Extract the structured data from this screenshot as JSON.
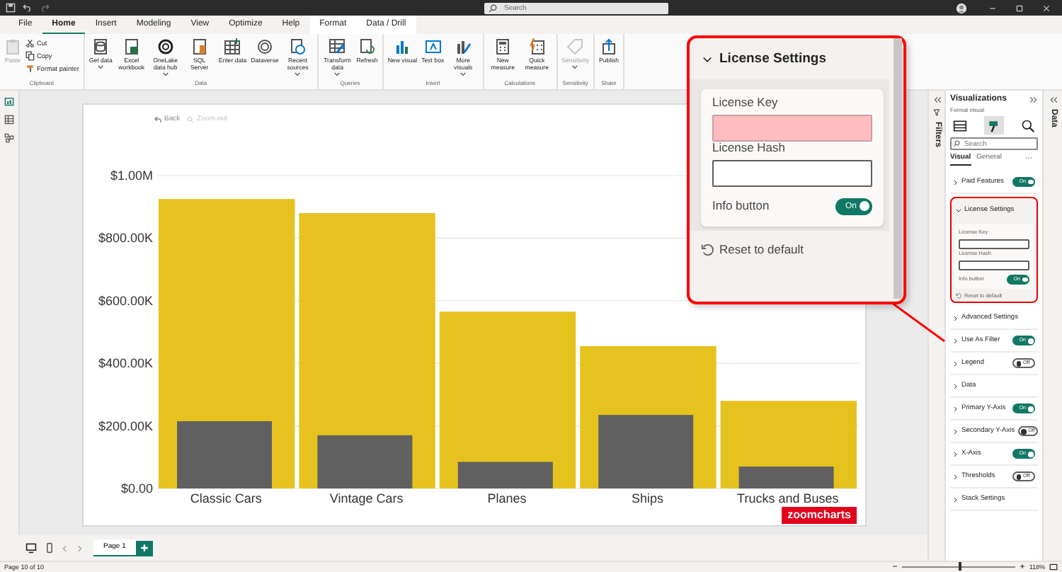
{
  "title_bar": {
    "search": {
      "placeholder": "Search"
    }
  },
  "menu": [
    {
      "label": "File",
      "selected": false,
      "kind": "standard"
    },
    {
      "label": "Home",
      "selected": true,
      "kind": "standard"
    },
    {
      "label": "Insert",
      "selected": false,
      "kind": "standard"
    },
    {
      "label": "Modeling",
      "selected": false,
      "kind": "standard"
    },
    {
      "label": "View",
      "selected": false,
      "kind": "standard"
    },
    {
      "label": "Optimize",
      "selected": false,
      "kind": "standard"
    },
    {
      "label": "Help",
      "selected": false,
      "kind": "standard"
    },
    {
      "label": "Format",
      "selected": false,
      "kind": "contextual"
    },
    {
      "label": "Data / Drill",
      "selected": false,
      "kind": "contextual"
    }
  ],
  "ribbon": [
    {
      "label": "Clipboard",
      "items": [
        {
          "label": "Paste",
          "kind": "large",
          "disabled": true,
          "dropdown": false
        },
        {
          "label": "Cut",
          "kind": "small",
          "disabled": false,
          "dropdown": false
        },
        {
          "label": "Copy",
          "kind": "small",
          "disabled": false,
          "dropdown": false
        },
        {
          "label": "Format painter",
          "kind": "small",
          "disabled": false,
          "dropdown": false
        }
      ]
    },
    {
      "label": "Data",
      "items": [
        {
          "label": "Get data",
          "kind": "large",
          "disabled": false,
          "dropdown": true
        },
        {
          "label": "Excel workbook",
          "kind": "large",
          "disabled": false,
          "dropdown": false
        },
        {
          "label": "OneLake data hub",
          "kind": "large",
          "disabled": false,
          "dropdown": true
        },
        {
          "label": "SQL Server",
          "kind": "large",
          "disabled": false,
          "dropdown": false
        },
        {
          "label": "Enter data",
          "kind": "large",
          "disabled": false,
          "dropdown": false
        },
        {
          "label": "Dataverse",
          "kind": "large",
          "disabled": false,
          "dropdown": false
        },
        {
          "label": "Recent sources",
          "kind": "large",
          "disabled": false,
          "dropdown": true
        }
      ]
    },
    {
      "label": "Queries",
      "items": [
        {
          "label": "Transform data",
          "kind": "large",
          "disabled": false,
          "dropdown": true
        },
        {
          "label": "Refresh",
          "kind": "large",
          "disabled": false,
          "dropdown": false
        }
      ]
    },
    {
      "label": "Insert",
      "items": [
        {
          "label": "New visual",
          "kind": "large",
          "disabled": false,
          "dropdown": false
        },
        {
          "label": "Text box",
          "kind": "large",
          "disabled": false,
          "dropdown": false
        },
        {
          "label": "More visuals",
          "kind": "large",
          "disabled": false,
          "dropdown": true
        }
      ]
    },
    {
      "label": "Calculations",
      "items": [
        {
          "label": "New measure",
          "kind": "large",
          "disabled": false,
          "dropdown": false
        },
        {
          "label": "Quick measure",
          "kind": "large",
          "disabled": false,
          "dropdown": false
        }
      ]
    },
    {
      "label": "Sensitivity",
      "items": [
        {
          "label": "Sensitivity",
          "kind": "large",
          "disabled": true,
          "dropdown": true
        }
      ]
    },
    {
      "label": "Share",
      "items": [
        {
          "label": "Publish",
          "kind": "large",
          "disabled": false,
          "dropdown": false
        }
      ]
    }
  ],
  "visual": {
    "toolbar": [
      {
        "label": "Back",
        "disabled": false
      },
      {
        "label": "Zoom-out",
        "disabled": true
      }
    ],
    "chart_data": {
      "type": "bar",
      "categories": [
        "Classic Cars",
        "Vintage Cars",
        "Planes",
        "Ships",
        "Trucks and Buses"
      ],
      "series": [
        {
          "color": "#e6c21e",
          "values": [
            925000,
            880000,
            565000,
            455000,
            280000
          ]
        },
        {
          "color": "#606060",
          "values": [
            215000,
            170000,
            85000,
            235000,
            70000
          ]
        }
      ],
      "ylim": [
        0,
        1000000
      ],
      "yticks": [
        {
          "value": 0,
          "label": "$0.00"
        },
        {
          "value": 200000,
          "label": "$200.00K"
        },
        {
          "value": 400000,
          "label": "$400.00K"
        },
        {
          "value": 600000,
          "label": "$600.00K"
        },
        {
          "value": 800000,
          "label": "$800.00K"
        },
        {
          "value": 1000000,
          "label": "$1.00M"
        }
      ],
      "stacked": false,
      "grid": true
    },
    "logo": "zoomcharts"
  },
  "page_tabs": [
    {
      "label": "Page 1",
      "selected": true
    }
  ],
  "status_bar": {
    "page": "Page 10 of 10",
    "zoom": "118%",
    "zoom_slider": {
      "level": 0.5
    }
  },
  "filters_pane": {
    "title": "Filters"
  },
  "visualizations": {
    "title": "Visualizations",
    "subtitle": "Format visual",
    "modes": [
      {
        "selected": false
      },
      {
        "selected": true
      },
      {
        "selected": false
      }
    ],
    "search": {
      "placeholder": "Search"
    },
    "tabs": [
      {
        "label": "Visual",
        "selected": true
      },
      {
        "label": "General",
        "selected": false
      }
    ],
    "more": "···",
    "sections": [
      {
        "label": "Paid Features",
        "expanded": false,
        "on": true,
        "toggle_text": "On"
      },
      {
        "label": "License Settings",
        "expanded": true,
        "highlighted": true,
        "fields": [
          {
            "label": "License Key",
            "invalid": false
          },
          {
            "label": "License Hash",
            "invalid": false
          }
        ],
        "toggle": {
          "label": "Info button",
          "on": true,
          "toggle_text": "On"
        },
        "reset": "Reset to default"
      },
      {
        "label": "Advanced Settings",
        "expanded": false
      },
      {
        "label": "Use As Filter",
        "expanded": false,
        "on": true,
        "toggle_text": "On"
      },
      {
        "label": "Legend",
        "expanded": false,
        "on": false,
        "toggle_text": "Off"
      },
      {
        "label": "Data",
        "expanded": false
      },
      {
        "label": "Primary Y-Axis",
        "expanded": false,
        "on": true,
        "toggle_text": "On"
      },
      {
        "label": "Secondary Y-Axis",
        "expanded": false,
        "on": false,
        "toggle_text": "Off"
      },
      {
        "label": "X-Axis",
        "expanded": false,
        "on": true,
        "toggle_text": "On"
      },
      {
        "label": "Thresholds",
        "expanded": false,
        "on": false,
        "toggle_text": "Off"
      },
      {
        "label": "Stack Settings",
        "expanded": false
      }
    ]
  },
  "data_pane": {
    "title": "Data"
  },
  "callout": {
    "title": "License Settings",
    "expanded": true,
    "fields": [
      {
        "label": "License Key",
        "invalid": true
      },
      {
        "label": "License Hash",
        "invalid": false
      }
    ],
    "toggle": {
      "label": "Info button",
      "on": true,
      "toggle_text": "On"
    },
    "reset": "Reset to default"
  }
}
